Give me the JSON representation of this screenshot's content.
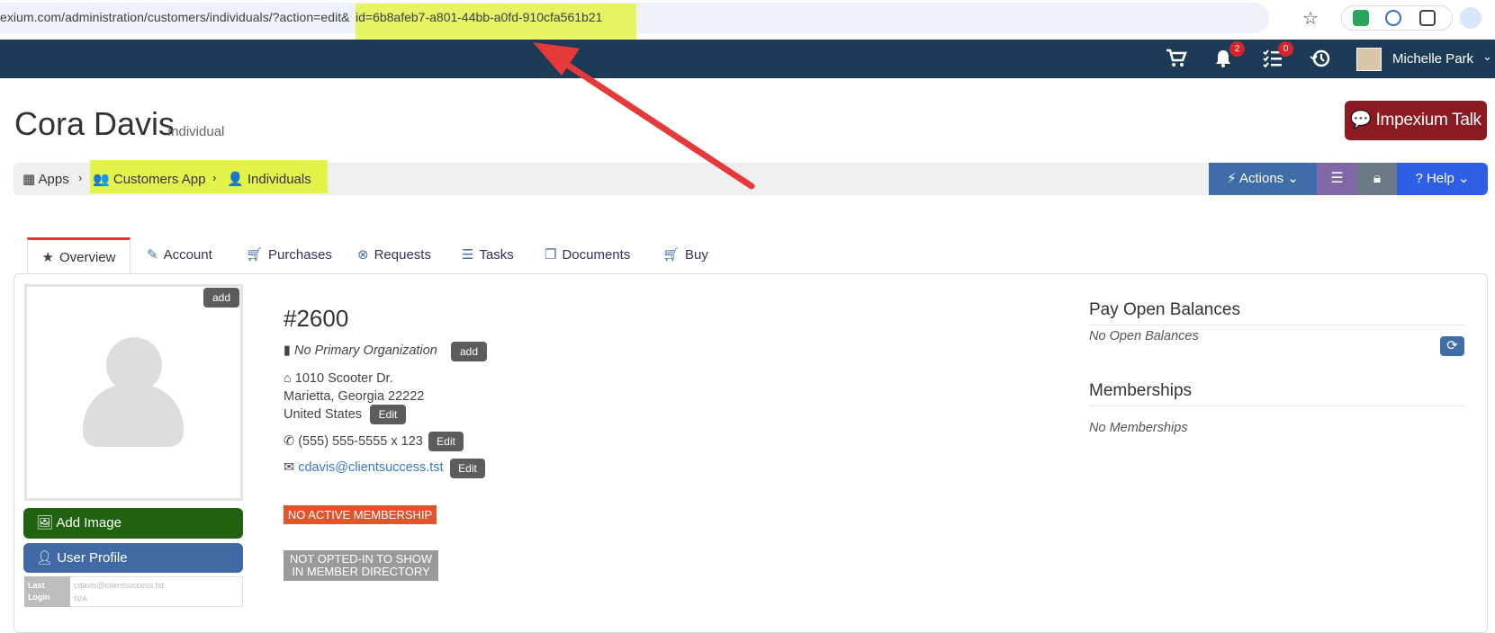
{
  "browser": {
    "url_prefix": "exium.com/administration/customers/individuals/?action=edit&",
    "url_highlight": "id=6b8afeb7-a801-44bb-a0fd-910cfa561b21"
  },
  "topnav": {
    "notifications_count": "2",
    "tasks_count": "0",
    "user_name": "Michelle Park"
  },
  "page": {
    "title": "Cora Davis",
    "subtitle": "Individual",
    "talk_button": "Impexium Talk"
  },
  "breadcrumb": {
    "items": [
      "Apps",
      "Customers App",
      "Individuals"
    ]
  },
  "toolbar": {
    "actions": "Actions",
    "help": "Help"
  },
  "tabs": [
    "Overview",
    "Account",
    "Purchases",
    "Requests",
    "Tasks",
    "Documents",
    "Buy"
  ],
  "profile": {
    "photo_add": "add",
    "add_image": "Add Image",
    "user_profile": "User Profile",
    "last_login_label": "Last Login",
    "username": "cdavis@clientsuccess.tst",
    "last_login_value": "N/A"
  },
  "details": {
    "number": "#2600",
    "organization": "No Primary Organization",
    "org_add": "add",
    "address_line1": "1010 Scooter Dr.",
    "address_line2": "Marietta, Georgia 22222",
    "address_line3": "United States",
    "phone": "(555) 555-5555 x 123",
    "email": "cdavis@clientsuccess.tst",
    "edit_label": "Edit",
    "membership_tag": "NO ACTIVE MEMBERSHIP",
    "directory_tag_line1": "NOT OPTED-IN TO SHOW",
    "directory_tag_line2": "IN MEMBER DIRECTORY"
  },
  "right": {
    "balances_title": "Pay Open Balances",
    "balances_empty": "No Open Balances",
    "memberships_title": "Memberships",
    "memberships_empty": "No Memberships"
  },
  "colors": {
    "nav_bg": "#1d3a56",
    "highlight": "#e4f34a",
    "arrow": "#e63a3a",
    "talk_btn": "#8b1a22",
    "add_image_btn": "#20620f",
    "membership_tag": "#e2542b"
  }
}
